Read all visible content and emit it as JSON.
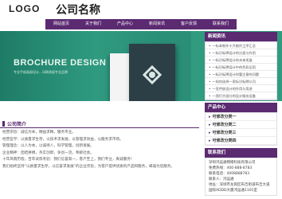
{
  "header": {
    "logo": "LOGO",
    "company": "公司名称"
  },
  "nav": [
    "网站首页",
    "关于我们",
    "产品中心",
    "新闻资讯",
    "客户反馈",
    "联系我们"
  ],
  "banner": {
    "title": "BROCHURE DESIGN",
    "subtitle": "专业手册画册设计，印刷承接专业品牌"
  },
  "sidebar": {
    "news_title": "新闻资讯",
    "news": [
      "一标本制作十大制作工序汇总",
      "一标识标牌设计的分类与作用",
      "一标识标牌设计的未来发展",
      "一标识标牌设计中的色彩运用",
      "一标识标牌设计时要注意的问题",
      "一如何选择一家标识标牌公司",
      "一宣传册设计的作用与用途",
      "一我们大部分的设计服务设备"
    ],
    "cat_title": "产品中心",
    "cats": [
      "可修改分类一",
      "可修改分类二",
      "可修改分类三",
      "可修改分类四"
    ],
    "contact_title": "联系我们",
    "contact": [
      "深圳鸿运通网络科技有限公司",
      "免费热线：400-888-8783",
      "联系电话：4008888783",
      "联系人：鸿运通",
      "地址：深圳市龙岗区布吉街道布吉大道",
      "国际ADDD大厦鸿运通1101室"
    ]
  },
  "intro": {
    "title": "公司简介",
    "paragraphs": [
      "经营宗旨：诚信为本，精益求精，服务专业。",
      "经营哲学：以质量求生存，以技术求发展，以管理求效益，以服务求市场。",
      "管理理念：以人为本，以诚待人，科学管理，创新发展。",
      "企业精神：团结拼搏，务实创新，争创一流，奉献社会。",
      "十年风雨历程，百年试炼考验：我们信誉第一，客户至上，我们专业，真诚服务！",
      "我们始终坚持“以质量求生存，以信誉求发展”的企业宗旨，为客户提供优质的产品和服务，竭诚为您服务。"
    ]
  }
}
